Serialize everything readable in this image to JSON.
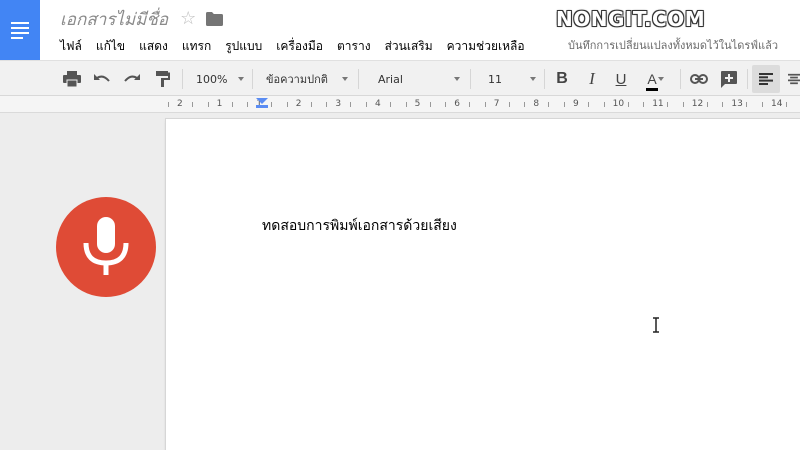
{
  "header": {
    "doc_title": "เอกสารไม่มีชื่อ",
    "watermark": "NONGIT.COM",
    "menu": [
      "ไฟล์",
      "แก้ไข",
      "แสดง",
      "แทรก",
      "รูปแบบ",
      "เครื่องมือ",
      "ตาราง",
      "ส่วนเสริม",
      "ความช่วยเหลือ"
    ],
    "save_status": "บันทึกการเปลี่ยนแปลงทั้งหมดไว้ในไดรฟ์แล้ว"
  },
  "toolbar": {
    "zoom": "100%",
    "style": "ข้อความปกติ",
    "font": "Arial",
    "font_size": "11",
    "bold_label": "B",
    "italic_label": "I",
    "underline_label": "U",
    "text_color_label": "A"
  },
  "ruler": {
    "numbers": [
      "2",
      "1",
      "1",
      "2",
      "3",
      "4",
      "5",
      "6",
      "7",
      "8",
      "9",
      "10",
      "11",
      "12",
      "13",
      "14"
    ]
  },
  "document": {
    "body_text": "ทดสอบการพิมพ์เอกสารด้วยเสียง"
  },
  "colors": {
    "brand_blue": "#4285f4",
    "mic_red": "#df4b36",
    "toolbar_bg": "#f1f1f1"
  },
  "icons": [
    "docs-logo-icon",
    "star-icon",
    "folder-icon",
    "print-icon",
    "undo-icon",
    "redo-icon",
    "paint-format-icon",
    "link-icon",
    "add-comment-icon",
    "align-left-icon",
    "align-center-icon",
    "microphone-icon",
    "text-cursor-icon"
  ]
}
